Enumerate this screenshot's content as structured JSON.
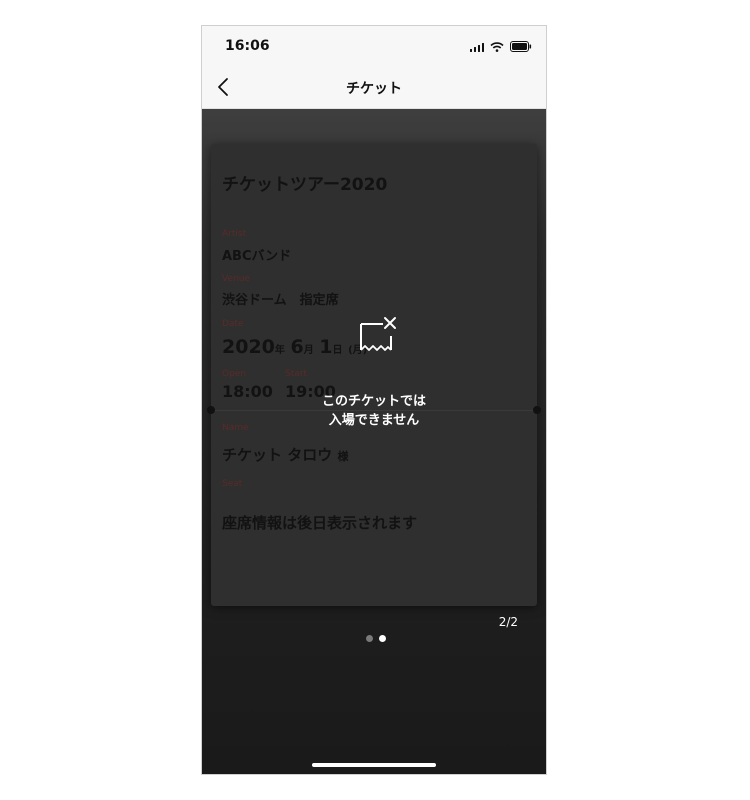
{
  "status": {
    "time": "16:06"
  },
  "nav": {
    "title": "チケット"
  },
  "ticket": {
    "title": "チケットツアー2020",
    "artist_label": "Artist",
    "artist": "ABCバンド",
    "venue_label": "Venue",
    "venue": "渋谷ドーム　指定席",
    "date_label": "Date",
    "date_year": "2020",
    "date_year_unit": "年",
    "date_month": "6",
    "date_month_unit": "月",
    "date_day": "1",
    "date_day_unit": "日",
    "date_weekday": "(月)",
    "open_label": "Open",
    "open_time": "18:00",
    "start_label": "Start",
    "start_time": "19:00",
    "name_label": "Name",
    "name": "チケット タロウ",
    "name_suffix": "様",
    "seat_label": "Seat",
    "seat": "座席情報は後日表示されます"
  },
  "overlay": {
    "icon": "ticket-invalid-icon",
    "line1": "このチケットでは",
    "line2": "入場できません"
  },
  "pager": {
    "count": "2/2",
    "total": 2,
    "active": 2
  }
}
